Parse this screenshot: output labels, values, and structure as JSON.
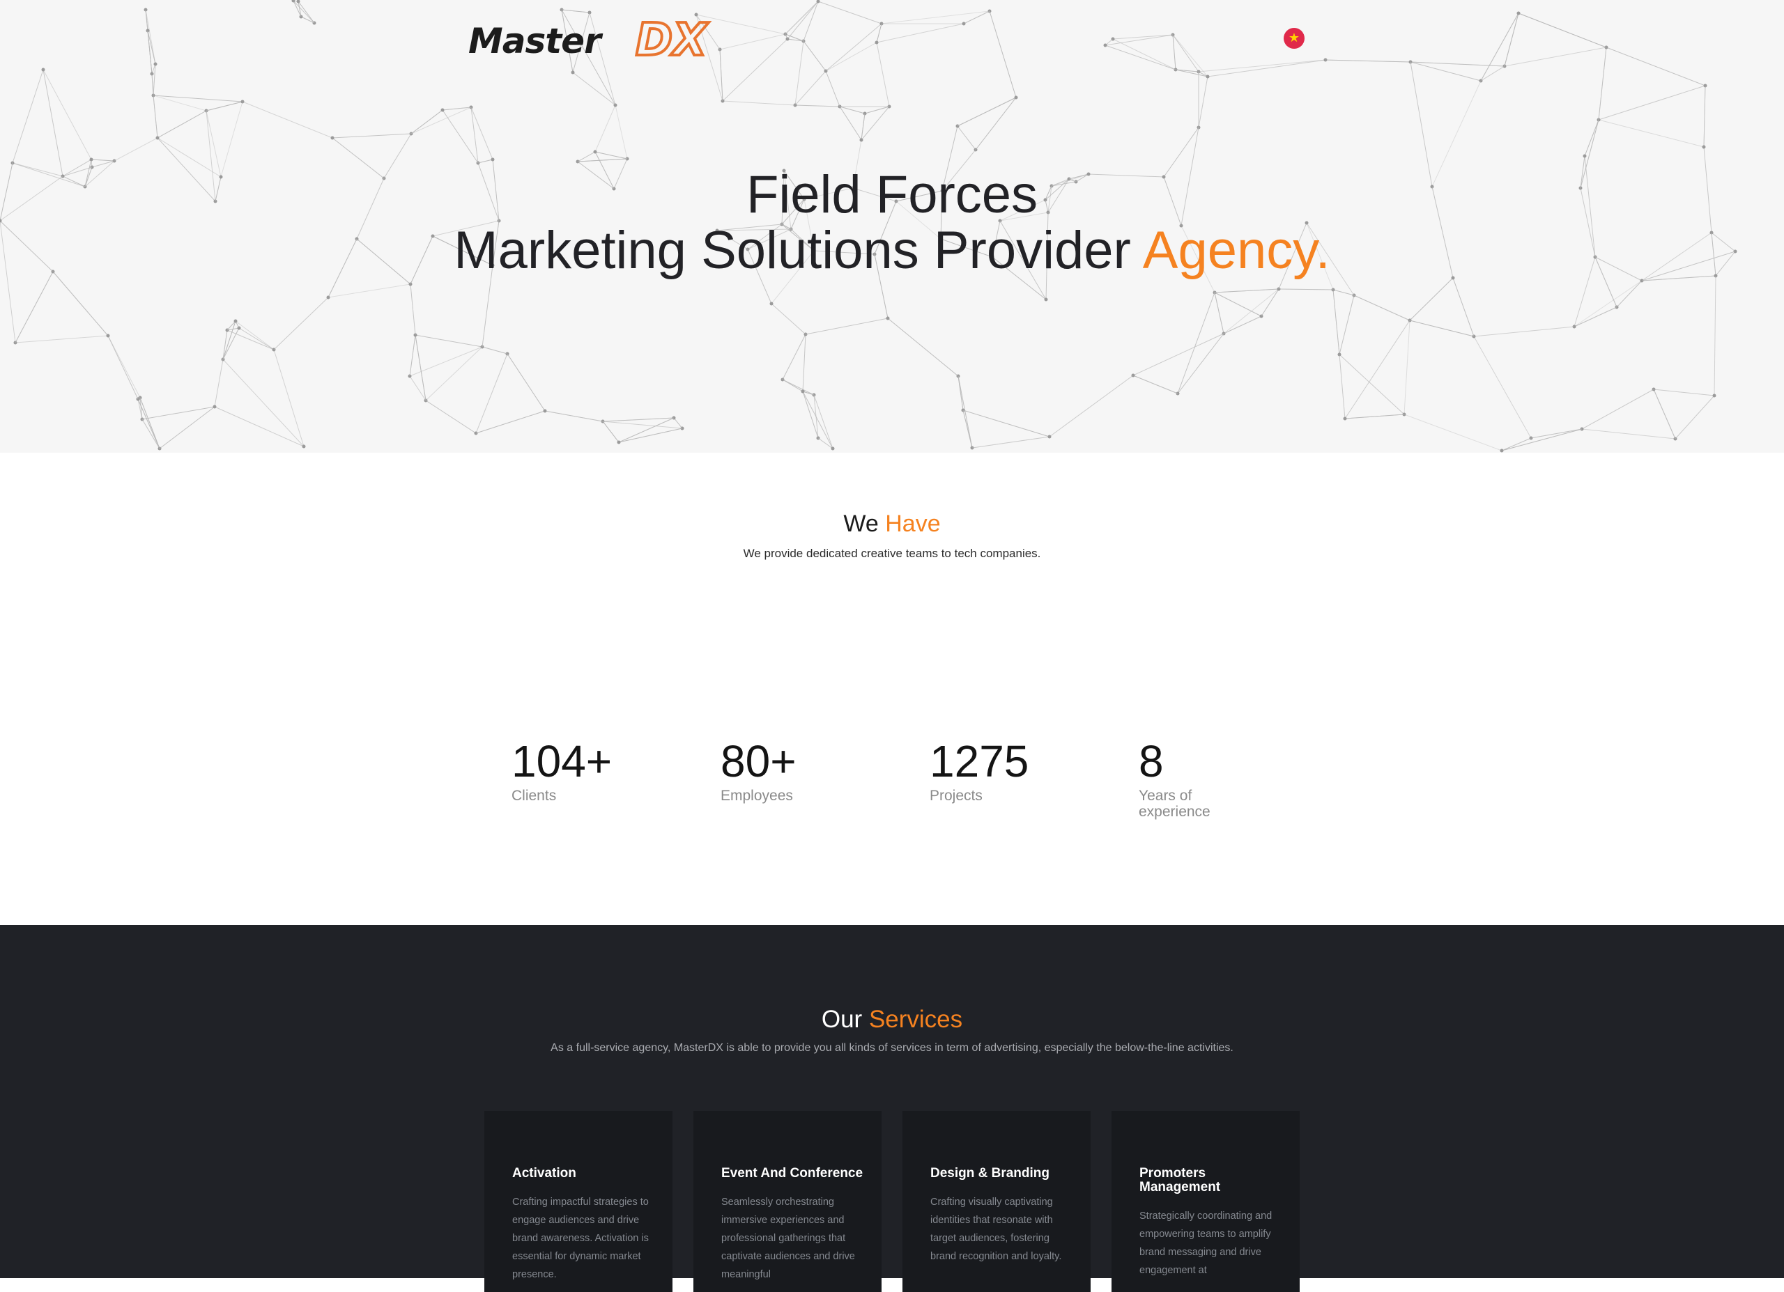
{
  "brand": {
    "logo_word": "Master",
    "logo_mark": "DX",
    "accent_color": "#f58220"
  },
  "header": {
    "language_icon": "vietnam-flag-icon"
  },
  "hero": {
    "line1": "Field Forces",
    "line2": "Marketing Solutions Provider",
    "accent": "Agency."
  },
  "we_have": {
    "title_plain": "We",
    "title_accent": "Have",
    "subtitle": "We provide dedicated creative teams to tech companies.",
    "stats": [
      {
        "value": "104+",
        "label": "Clients"
      },
      {
        "value": "80+",
        "label": "Employees"
      },
      {
        "value": "1275",
        "label": "Projects"
      },
      {
        "value": "8",
        "label": "Years of experience"
      }
    ]
  },
  "services": {
    "title_plain": "Our",
    "title_accent": "Services",
    "subtitle": "As a full-service agency, MasterDX is able to provide you all kinds of services in term of advertising, especially the below-the-line activities.",
    "cards": [
      {
        "title": "Activation",
        "desc": "Crafting impactful strategies to engage audiences and drive brand awareness. Activation is essential for dynamic market presence."
      },
      {
        "title": "Event And Conference",
        "desc": "Seamlessly orchestrating immersive experiences and professional gatherings that captivate audiences and drive meaningful"
      },
      {
        "title": "Design & Branding",
        "desc": "Crafting visually captivating identities that resonate with target audiences, fostering brand recognition and loyalty."
      },
      {
        "title": "Promoters Management",
        "desc": "Strategically coordinating and empowering teams to amplify brand messaging and drive engagement at"
      }
    ]
  }
}
